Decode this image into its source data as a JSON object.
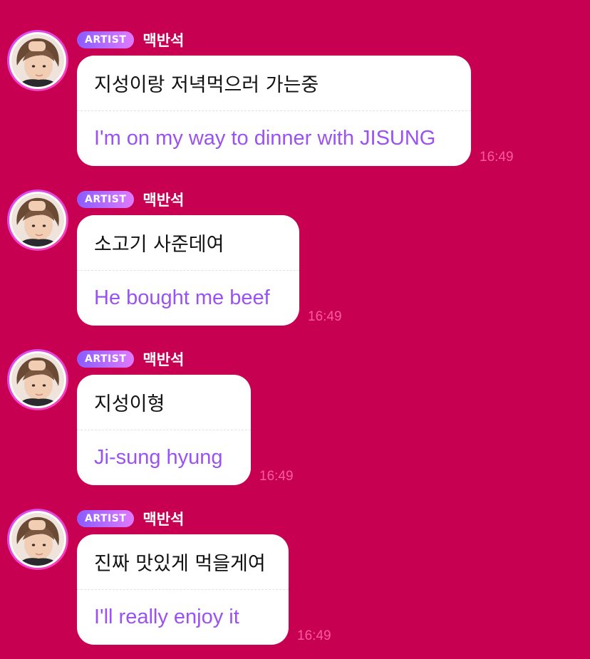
{
  "messages": [
    {
      "badge": "ARTIST",
      "sender": "맥반석",
      "original": "지성이랑 저녁먹으러 가는중",
      "translation": "I'm on my way to dinner with JISUNG",
      "time": "16:49"
    },
    {
      "badge": "ARTIST",
      "sender": "맥반석",
      "original": "소고기 사준데여",
      "translation": "He bought me beef",
      "time": "16:49"
    },
    {
      "badge": "ARTIST",
      "sender": "맥반석",
      "original": "지성이형",
      "translation": "Ji-sung hyung",
      "time": "16:49"
    },
    {
      "badge": "ARTIST",
      "sender": "맥반석",
      "original": "진짜 맛있게 먹을게여",
      "translation": "I'll really enjoy it",
      "time": "16:49"
    }
  ],
  "colors": {
    "background": "#c80052",
    "translation_text": "#9a52f2",
    "timestamp": "#ff5c9d",
    "badge_gradient_start": "#8a5cff",
    "badge_gradient_end": "#e07bff"
  },
  "icons": {
    "avatar": "profile-photo"
  }
}
